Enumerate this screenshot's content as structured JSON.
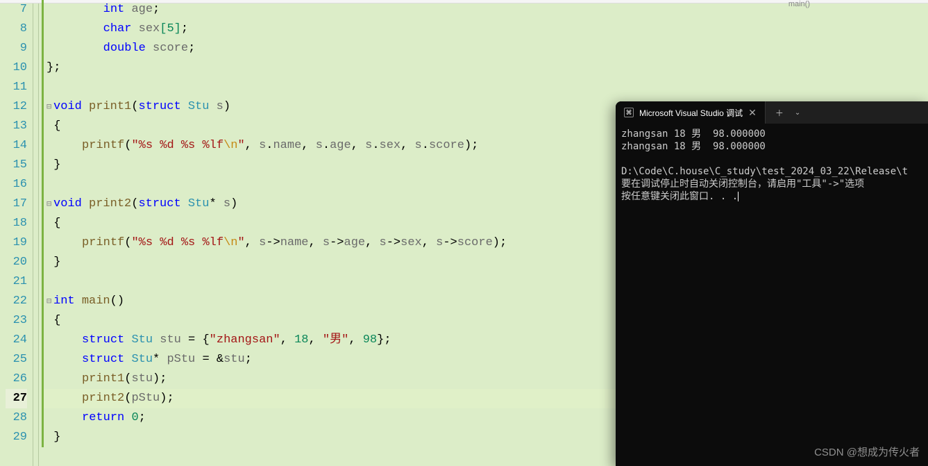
{
  "top": {
    "right_hint": "main()"
  },
  "gutter": {
    "start": 7,
    "end": 29,
    "current": 27
  },
  "code": {
    "l7": {
      "kw1": "int",
      "id1": "age",
      "t1": "        ",
      "t2": " ",
      "t3": ";"
    },
    "l8": {
      "kw1": "char",
      "id1": "sex",
      "arr": "[5]",
      "t1": "        ",
      "t2": " ",
      "t3": ";"
    },
    "l9": {
      "kw1": "double",
      "id1": "score",
      "t1": "        ",
      "t2": " ",
      "t3": ";"
    },
    "l10": {
      "t1": "};"
    },
    "l11": {
      "t1": ""
    },
    "l12": {
      "kw1": "void",
      "fn": "print1",
      "lp": "(",
      "kw2": "struct",
      "ty": "Stu",
      "id1": "s",
      "rp": ")"
    },
    "l13": {
      "t1": "{"
    },
    "l14": {
      "fn": "printf",
      "lp": "(",
      "str": "\"%s %d %s %lf",
      "esc": "\\n",
      "strend": "\"",
      "c1": ", ",
      "id_s1": "s",
      "d1": ".",
      "m1": "name",
      "c2": ", ",
      "id_s2": "s",
      "d2": ".",
      "m2": "age",
      "c3": ", ",
      "id_s3": "s",
      "d3": ".",
      "m3": "sex",
      "c4": ", ",
      "id_s4": "s",
      "d4": ".",
      "m4": "score",
      "rp": ")",
      "sc": ";"
    },
    "l15": {
      "t1": "}"
    },
    "l16": {
      "t1": ""
    },
    "l17": {
      "kw1": "void",
      "fn": "print2",
      "lp": "(",
      "kw2": "struct",
      "ty": "Stu",
      "star": "*",
      "id1": "s",
      "rp": ")"
    },
    "l18": {
      "t1": "{"
    },
    "l19": {
      "fn": "printf",
      "lp": "(",
      "str": "\"%s %d %s %lf",
      "esc": "\\n",
      "strend": "\"",
      "c1": ", ",
      "id_s1": "s",
      "d1": "->",
      "m1": "name",
      "c2": ", ",
      "id_s2": "s",
      "d2": "->",
      "m2": "age",
      "c3": ", ",
      "id_s3": "s",
      "d3": "->",
      "m3": "sex",
      "c4": ", ",
      "id_s4": "s",
      "d4": "->",
      "m4": "score",
      "rp": ")",
      "sc": ";"
    },
    "l20": {
      "t1": "}"
    },
    "l21": {
      "t1": ""
    },
    "l22": {
      "kw1": "int",
      "fn": "main",
      "pp": "()"
    },
    "l23": {
      "t1": "{"
    },
    "l24": {
      "kw1": "struct",
      "ty": "Stu",
      "id1": "stu",
      "eq": " = {",
      "s1": "\"zhangsan\"",
      "c1": ", ",
      "n1": "18",
      "c2": ", ",
      "s2": "\"男\"",
      "c3": ", ",
      "n2": "98",
      "end": "};"
    },
    "l25": {
      "kw1": "struct",
      "ty": "Stu",
      "star": "*",
      "id1": "pStu",
      "eq": " = &",
      "id2": "stu",
      "sc": ";"
    },
    "l26": {
      "fn": "print1",
      "lp": "(",
      "id1": "stu",
      "rp": ")",
      "sc": ";"
    },
    "l27": {
      "fn": "print2",
      "lp": "(",
      "id1": "pStu",
      "rp": ")",
      "sc": ";"
    },
    "l28": {
      "kw1": "return",
      "sp": " ",
      "n1": "0",
      "sc": ";"
    },
    "l29": {
      "t1": "}"
    }
  },
  "console": {
    "title": "Microsoft Visual Studio 调试",
    "out1": "zhangsan 18 男  98.000000",
    "out2": "zhangsan 18 男  98.000000",
    "blank": "",
    "path": "D:\\Code\\C.house\\C_study\\test_2024_03_22\\Release\\t",
    "hint1": "要在调试停止时自动关闭控制台，请启用\"工具\"->\"选项",
    "hint2": "按任意键关闭此窗口. . ."
  },
  "watermark": "CSDN @想成为传火者"
}
